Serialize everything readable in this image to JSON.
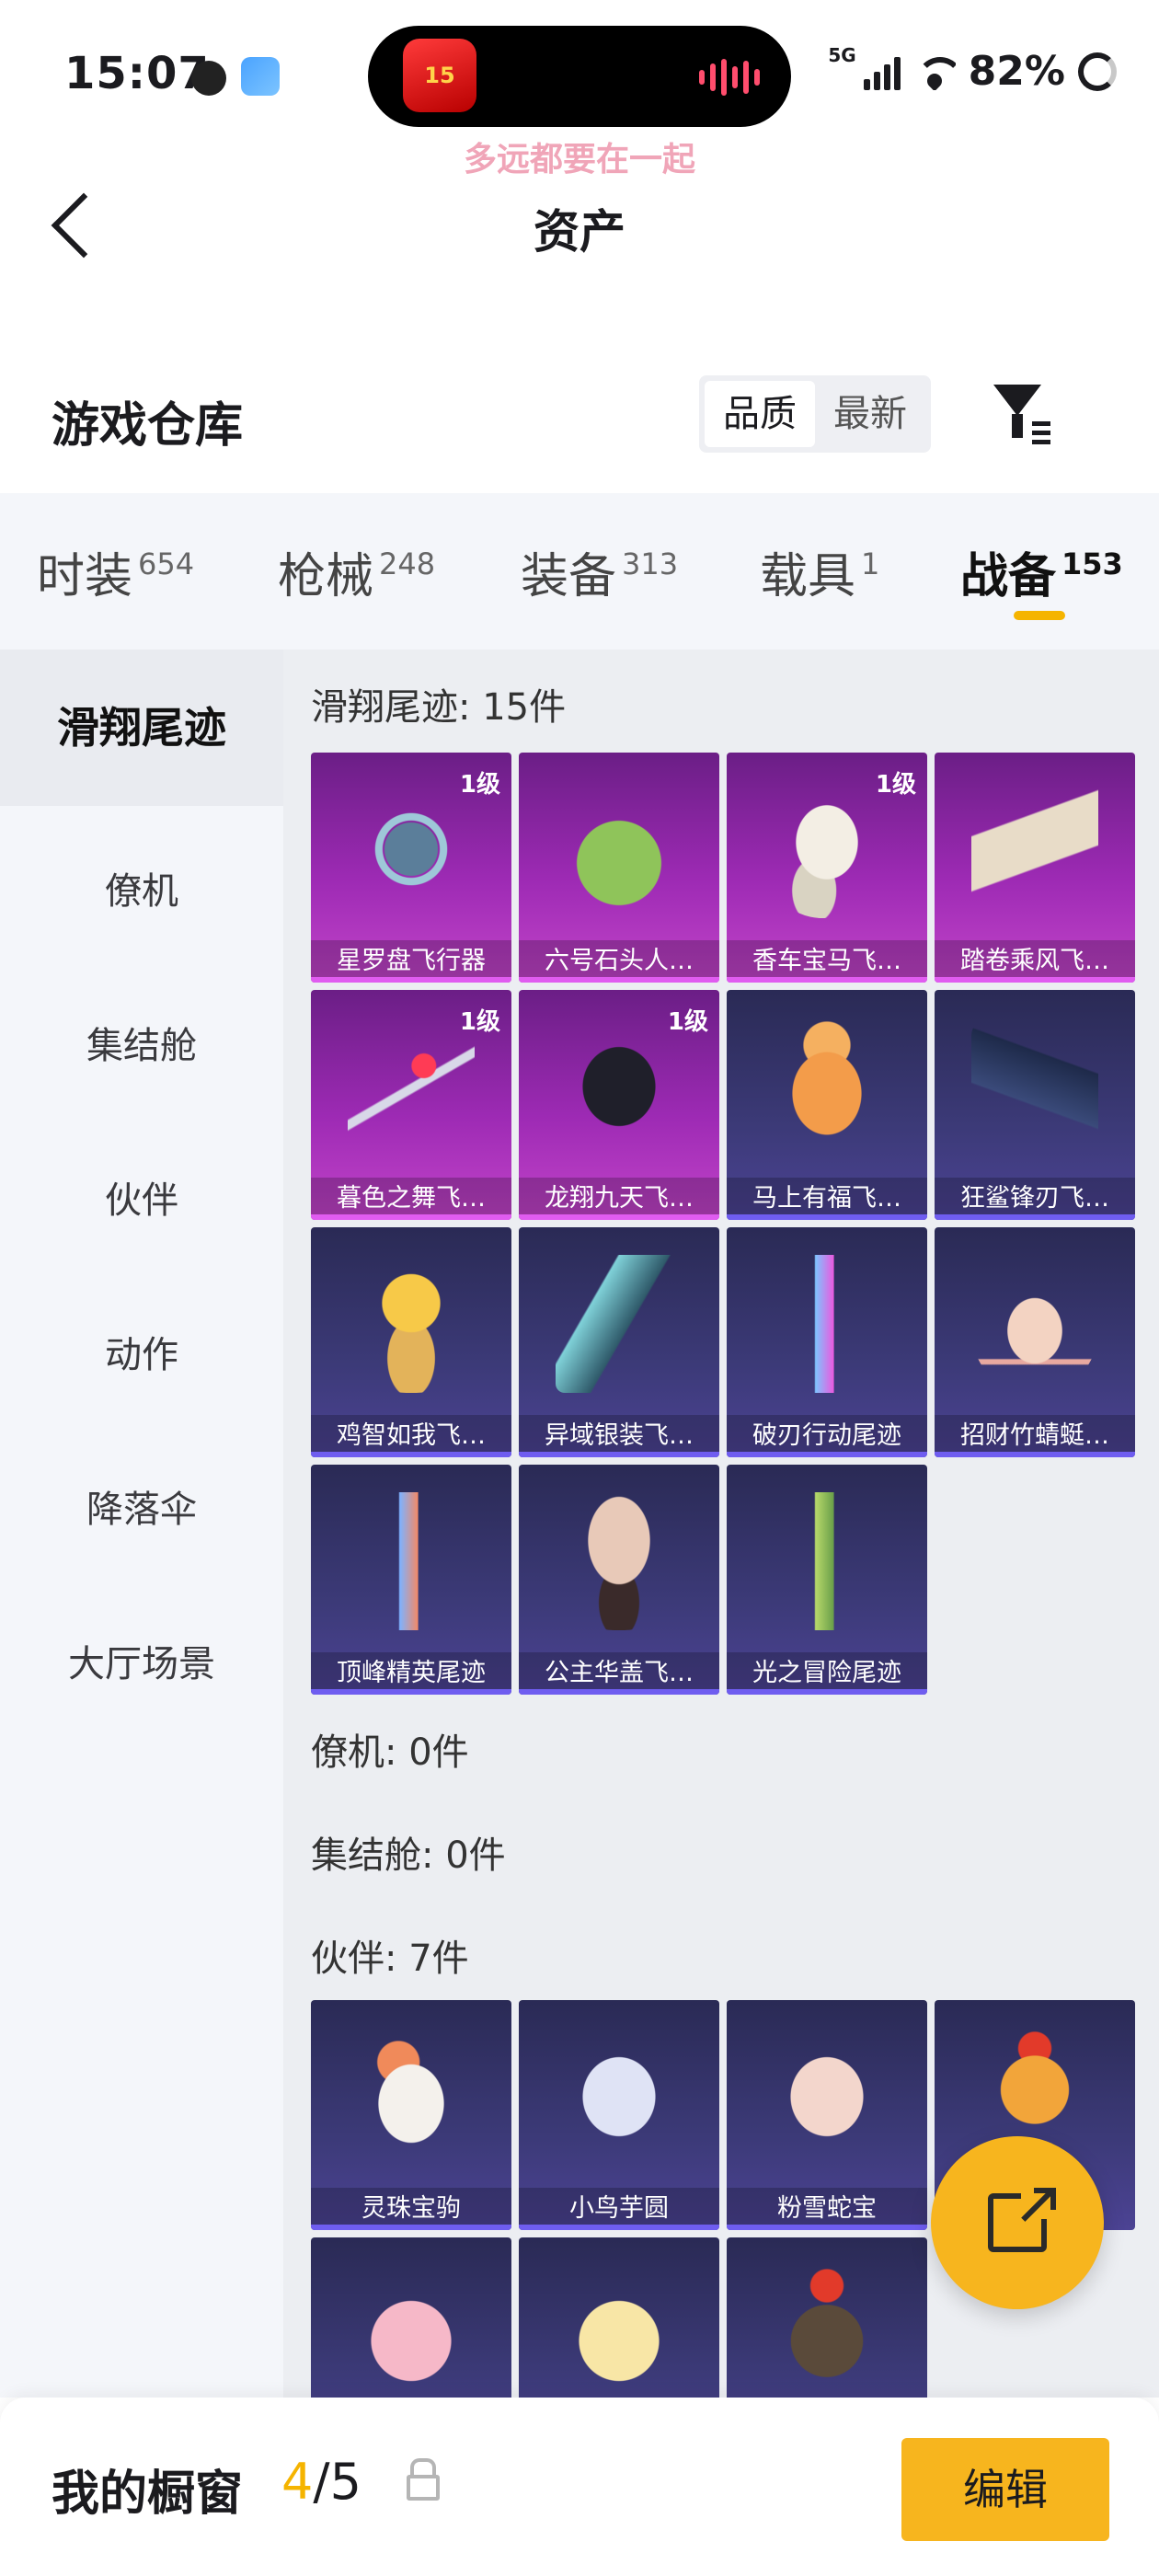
{
  "status_bar": {
    "time": "15:07",
    "network": "5G",
    "battery": "82%",
    "island_app_label": "15"
  },
  "marquee": "多远都要在一起",
  "header": {
    "title": "资产"
  },
  "warehouse": {
    "title": "游戏仓库",
    "sort_options": [
      "品质",
      "最新"
    ],
    "active_sort": "品质"
  },
  "categories": [
    {
      "label": "时装",
      "count": "654"
    },
    {
      "label": "枪械",
      "count": "248"
    },
    {
      "label": "装备",
      "count": "313"
    },
    {
      "label": "载具",
      "count": "1"
    },
    {
      "label": "战备",
      "count": "153"
    }
  ],
  "active_category": "战备",
  "side_nav": [
    "滑翔尾迹",
    "僚机",
    "集结舱",
    "伙伴",
    "动作",
    "降落伞",
    "大厅场景"
  ],
  "active_side": "滑翔尾迹",
  "sections": {
    "glide": {
      "title": "滑翔尾迹: 15件",
      "items": [
        {
          "name": "星罗盘飞行器",
          "level": "1级",
          "rarity": "purple"
        },
        {
          "name": "六号石头人…",
          "level": "",
          "rarity": "purple"
        },
        {
          "name": "香车宝马飞…",
          "level": "1级",
          "rarity": "purple"
        },
        {
          "name": "踏卷乘风飞…",
          "level": "",
          "rarity": "purple"
        },
        {
          "name": "暮色之舞飞…",
          "level": "1级",
          "rarity": "purple"
        },
        {
          "name": "龙翔九天飞…",
          "level": "1级",
          "rarity": "purple"
        },
        {
          "name": "马上有福飞…",
          "level": "",
          "rarity": "blue"
        },
        {
          "name": "狂鲨锋刃飞…",
          "level": "",
          "rarity": "blue"
        },
        {
          "name": "鸡智如我飞…",
          "level": "",
          "rarity": "blue"
        },
        {
          "name": "异域银装飞…",
          "level": "",
          "rarity": "blue"
        },
        {
          "name": "破刃行动尾迹",
          "level": "",
          "rarity": "blue"
        },
        {
          "name": "招财竹蜻蜓…",
          "level": "",
          "rarity": "blue"
        },
        {
          "name": "顶峰精英尾迹",
          "level": "",
          "rarity": "blue"
        },
        {
          "name": "公主华盖飞…",
          "level": "",
          "rarity": "blue"
        },
        {
          "name": "光之冒险尾迹",
          "level": "",
          "rarity": "blue"
        }
      ]
    },
    "wingman": {
      "title": "僚机: 0件"
    },
    "capsule": {
      "title": "集结舱: 0件"
    },
    "partner": {
      "title": "伙伴: 7件",
      "items": [
        {
          "name": "灵珠宝驹",
          "rarity": "blue"
        },
        {
          "name": "小鸟芋圆",
          "rarity": "blue"
        },
        {
          "name": "粉雪蛇宝",
          "rarity": "blue"
        },
        {
          "name": "",
          "rarity": "blue"
        },
        {
          "name": "",
          "rarity": "blue"
        },
        {
          "name": "",
          "rarity": "blue"
        },
        {
          "name": "",
          "rarity": "blue"
        }
      ]
    }
  },
  "bottom_bar": {
    "label": "我的橱窗",
    "current": "4",
    "separator": "/",
    "total": "5",
    "edit_label": "编辑"
  },
  "colors": {
    "accent": "#f5b400",
    "purple_rarity": "#9d2ab4",
    "blue_rarity": "#3c3a78"
  },
  "icons": [
    "back-icon",
    "filter-icon",
    "share-icon",
    "lock-icon"
  ]
}
